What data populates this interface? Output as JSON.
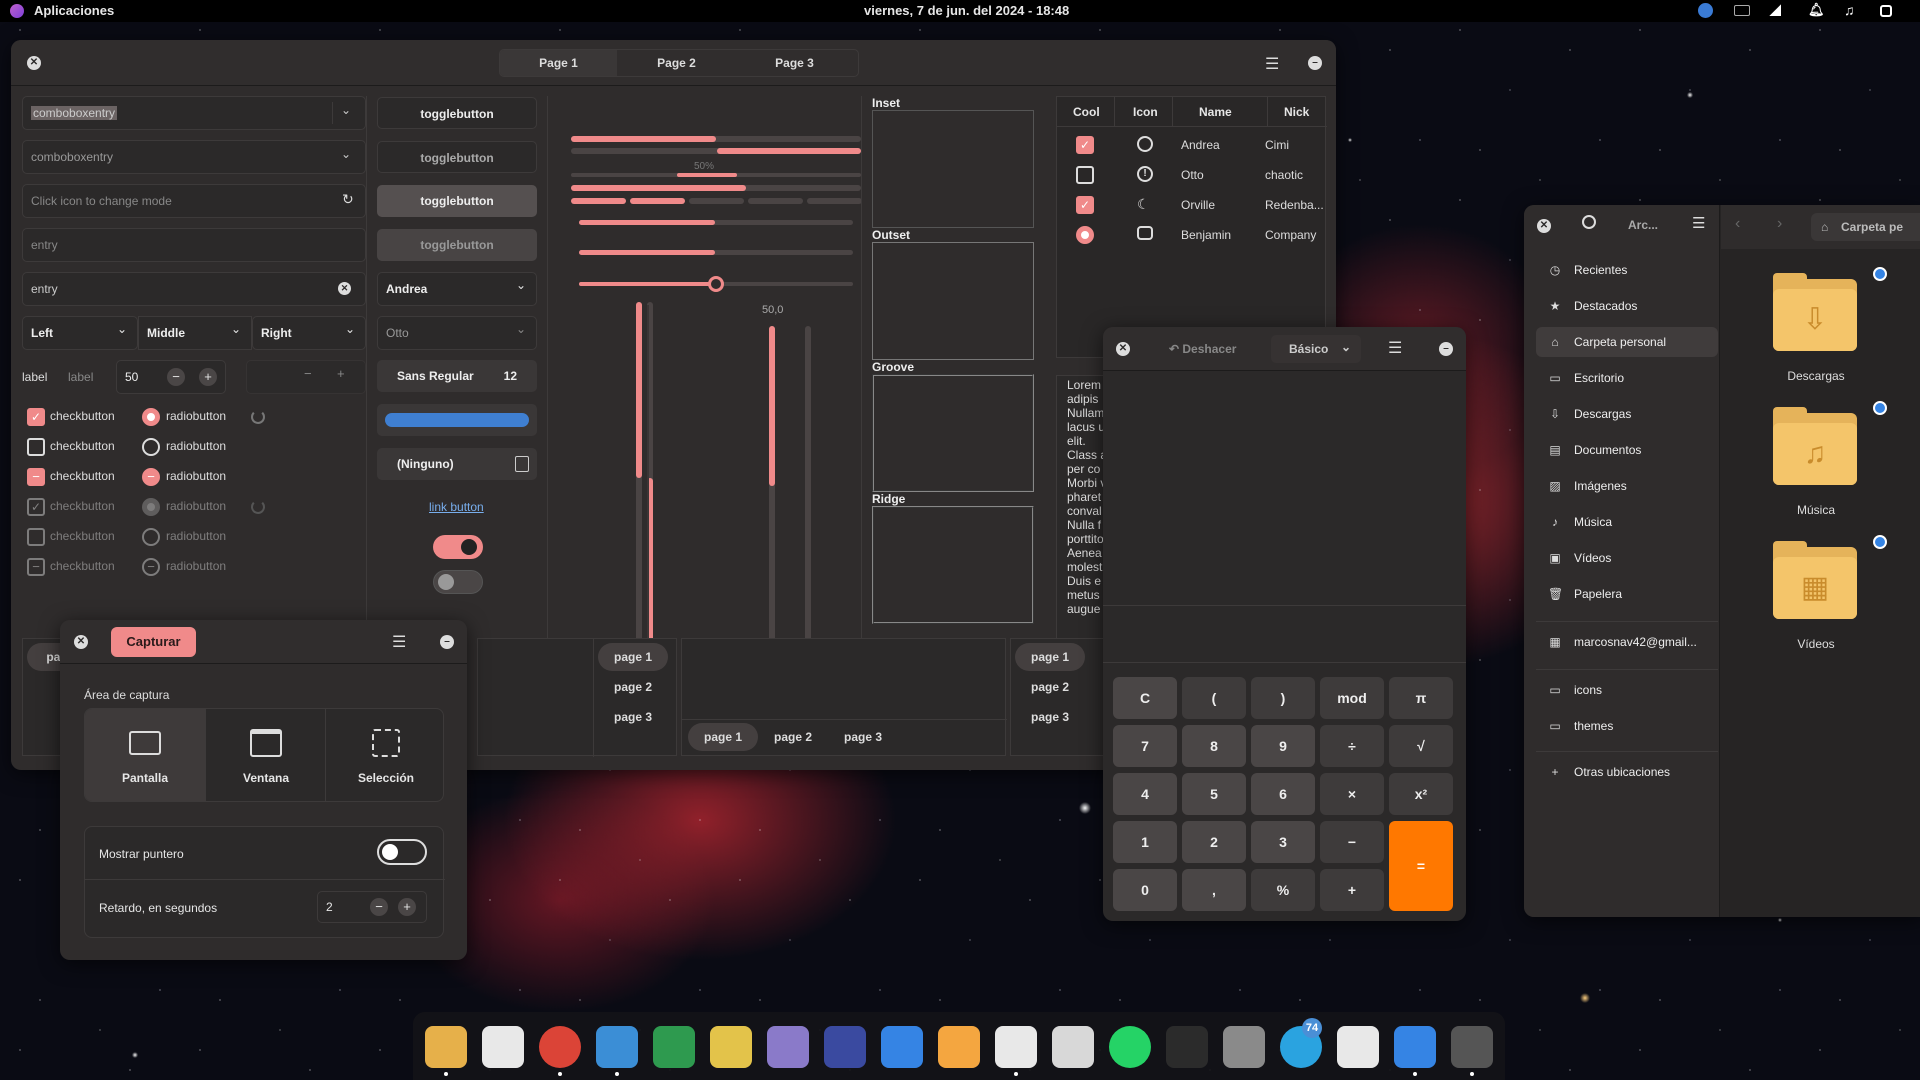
{
  "topbar": {
    "apps": "Aplicaciones",
    "datetime": "viernes,  7 de jun. del 2024 - 18:48"
  },
  "gtk": {
    "tabs": [
      "Page 1",
      "Page 2",
      "Page 3"
    ],
    "combo1": "comboboxentry",
    "combo2": "comboboxentry",
    "entry_icon_placeholder": "Click icon to change mode",
    "entry1": "entry",
    "entry2": "entry",
    "drop": [
      "Left",
      "Middle",
      "Right"
    ],
    "label1": "label",
    "label2": "label",
    "spin_value": "50",
    "checkbutton": "checkbutton",
    "radiobutton": "radiobutton",
    "toggle": "togglebutton",
    "combo_andrea": "Andrea",
    "combo_otto": "Otto",
    "font_name": "Sans Regular",
    "font_size": "12",
    "file_none": "(Ninguno)",
    "link": "link button",
    "progress_label": "50%",
    "scale_value": "50,0",
    "frames": [
      "Inset",
      "Outset",
      "Groove",
      "Ridge"
    ],
    "tree": {
      "headers": [
        "Cool",
        "Icon",
        "Name",
        "Nick"
      ],
      "rows": [
        {
          "name": "Andrea",
          "nick": "Cimi"
        },
        {
          "name": "Otto",
          "nick": "chaotic"
        },
        {
          "name": "Orville",
          "nick": "Redenba..."
        },
        {
          "name": "Benjamin",
          "nick": "Company"
        }
      ]
    },
    "lorem": [
      "Lorem",
      "adipis",
      "Nullam",
      "lacus u",
      "elit.",
      "Class a",
      "per co",
      "Morbi v",
      "pharet",
      "conval",
      "Nulla f",
      "porttito",
      "Aenea",
      "molest",
      "Duis e",
      "metus",
      "augue"
    ],
    "pages": [
      "page 1",
      "page 2",
      "page 3"
    ],
    "pag_partial": "pag"
  },
  "capture": {
    "title": "Capturar",
    "area_label": "Área de captura",
    "modes": [
      "Pantalla",
      "Ventana",
      "Selección"
    ],
    "pointer_label": "Mostrar puntero",
    "delay_label": "Retardo, en segundos",
    "delay_value": "2"
  },
  "calc": {
    "undo": "Deshacer",
    "mode": "Básico",
    "keys": [
      [
        "C",
        "(",
        ")",
        "mod",
        "π"
      ],
      [
        "7",
        "8",
        "9",
        "÷",
        "√"
      ],
      [
        "4",
        "5",
        "6",
        "×",
        "x²"
      ],
      [
        "1",
        "2",
        "3",
        "−"
      ],
      [
        "0",
        ",",
        "%",
        "+"
      ]
    ],
    "equals": "="
  },
  "files": {
    "title": "Arc...",
    "path": "Carpeta pe",
    "nav": [
      "Recientes",
      "Destacados",
      "Carpeta personal",
      "Escritorio",
      "Descargas",
      "Documentos",
      "Imágenes",
      "Música",
      "Vídeos",
      "Papelera"
    ],
    "account": "marcosnav42@gmail...",
    "bookmarks": [
      "icons",
      "themes"
    ],
    "other": "Otras ubicaciones",
    "folders": [
      "Descargas",
      "Música",
      "Vídeos"
    ]
  },
  "dock": {
    "badge": "74"
  }
}
